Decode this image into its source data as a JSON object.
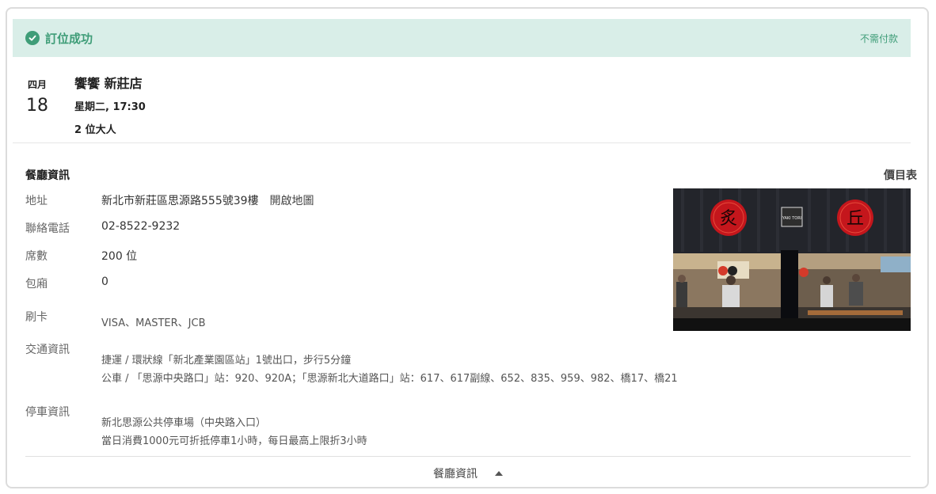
{
  "banner": {
    "title": "訂位成功",
    "payment": "不需付款",
    "accent": "#3f9d78",
    "bg": "#d9eee8"
  },
  "reservation": {
    "month": "四月",
    "day": "18",
    "restaurant": "饗饗 新莊店",
    "datetime": "星期二, 17:30",
    "guests": "2 位大人"
  },
  "info": {
    "section_title": "餐廳資訊",
    "menu_link": "價目表",
    "address_label": "地址",
    "address": "新北市新莊區思源路555號39樓",
    "map_link": "開啟地圖",
    "phone_label": "聯絡電話",
    "phone": "02-8522-9232",
    "seats_label": "席數",
    "seats": "200 位",
    "private_label": "包廂",
    "private": "0",
    "card_label": "刷卡",
    "cards": "VISA、MASTER、JCB",
    "transit_label": "交通資訊",
    "transit_line1": "捷運 / 環狀線「新北產業園區站」1號出口，步行5分鐘",
    "transit_line2": "公車 / 「思源中央路口」站：920、920A；「思源新北大道路口」站：617、617副線、652、835、959、982、橋17、橋21",
    "parking_label": "停車資訊",
    "parking_line1": "新北思源公共停車場（中央路入口）",
    "parking_line2": "當日消費1000元可折抵停車1小時，每日最高上限折3小時"
  },
  "photo": {
    "sign_left": "炙",
    "sign_center": "YAKI TORI",
    "sign_right": "丘"
  },
  "footer": {
    "label": "餐廳資訊"
  }
}
